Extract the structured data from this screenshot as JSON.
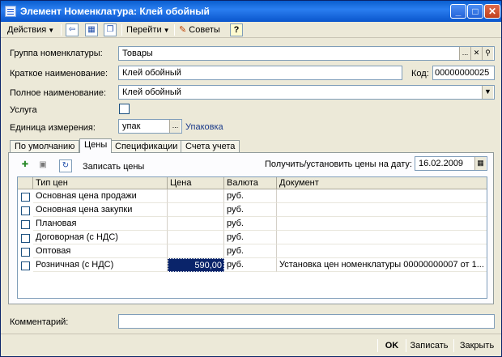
{
  "window": {
    "title": "Элемент Номенклатура: Клей обойный",
    "controls": {
      "minimize": "_",
      "maximize": "□",
      "close": "✕"
    }
  },
  "toolbar": {
    "actions_label": "Действия",
    "goto_label": "Перейти",
    "tips_label": "Советы",
    "help_label": "?"
  },
  "form": {
    "group_label": "Группа номенклатуры:",
    "group_value": "Товары",
    "short_name_label": "Краткое наименование:",
    "short_name_value": "Клей обойный",
    "code_label": "Код:",
    "code_value": "00000000025",
    "full_name_label": "Полное наименование:",
    "full_name_value": "Клей обойный",
    "service_label": "Услуга",
    "unit_label": "Единица измерения:",
    "unit_value": "упак",
    "unit_link": "Упаковка",
    "comment_label": "Комментарий:",
    "comment_value": ""
  },
  "tabs": [
    "По умолчанию",
    "Цены",
    "Спецификации",
    "Счета учета"
  ],
  "active_tab": "Цены",
  "prices_tab": {
    "save_prices_label": "Записать цены",
    "date_label": "Получить/установить цены на дату:",
    "date_value": "16.02.2009",
    "columns": [
      "Тип цен",
      "Цена",
      "Валюта",
      "Документ"
    ],
    "rows": [
      {
        "type": "Основная цена продажи",
        "price": "",
        "currency": "руб.",
        "document": ""
      },
      {
        "type": "Основная цена закупки",
        "price": "",
        "currency": "руб.",
        "document": ""
      },
      {
        "type": "Плановая",
        "price": "",
        "currency": "руб.",
        "document": ""
      },
      {
        "type": "Договорная (с НДС)",
        "price": "",
        "currency": "руб.",
        "document": ""
      },
      {
        "type": "Оптовая",
        "price": "",
        "currency": "руб.",
        "document": ""
      },
      {
        "type": "Розничная (с НДС)",
        "price": "590,00",
        "currency": "руб.",
        "document": "Установка цен номенклатуры 00000000007 от 1..."
      }
    ]
  },
  "footer": {
    "ok_label": "OK",
    "save_label": "Записать",
    "close_label": "Закрыть"
  }
}
